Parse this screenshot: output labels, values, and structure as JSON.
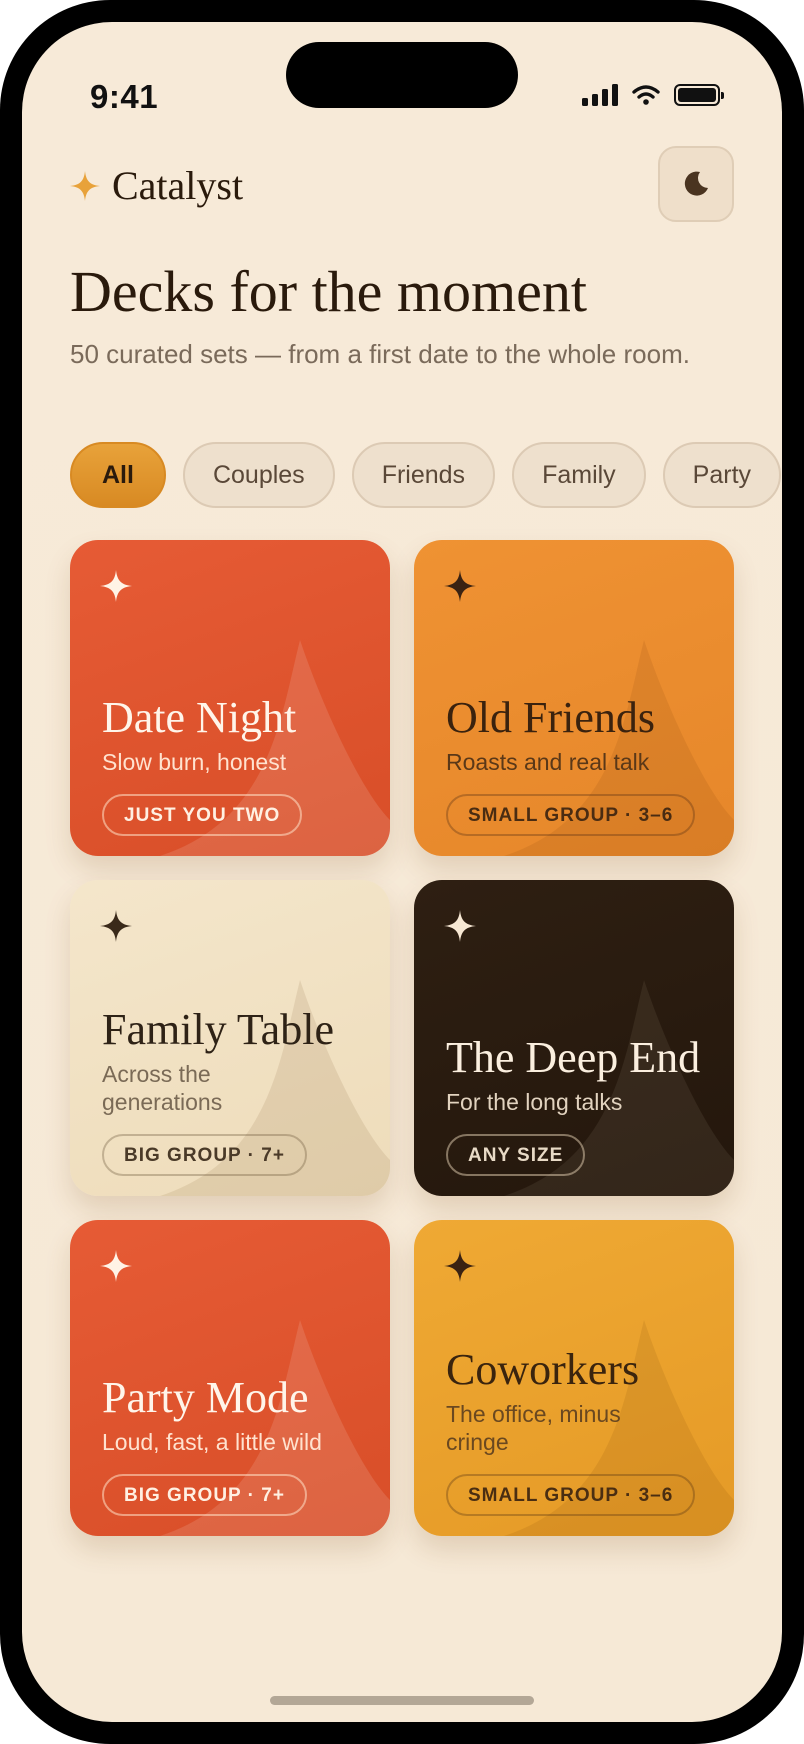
{
  "status_bar": {
    "time": "9:41"
  },
  "app": {
    "name": "Catalyst"
  },
  "header": {
    "title": "Decks for the moment",
    "subtitle": "50 curated sets — from a first date to the whole room."
  },
  "filters": [
    {
      "label": "All",
      "selected": true
    },
    {
      "label": "Couples",
      "selected": false
    },
    {
      "label": "Friends",
      "selected": false
    },
    {
      "label": "Family",
      "selected": false
    },
    {
      "label": "Party",
      "selected": false
    }
  ],
  "decks": [
    {
      "title": "Date Night",
      "subtitle": "Slow burn, honest",
      "badge": "JUST YOU TWO",
      "color": "#e65b35",
      "star_color": "#fff3e6"
    },
    {
      "title": "Old Friends",
      "subtitle": "Roasts and real talk",
      "badge": "SMALL GROUP · 3–6",
      "color": "#ef9233",
      "star_color": "#3a2212"
    },
    {
      "title": "Family Table",
      "subtitle": "Across the generations",
      "badge": "BIG GROUP · 7+",
      "color": "#f4e6cb",
      "star_color": "#3a2a1a"
    },
    {
      "title": "The Deep End",
      "subtitle": "For the long talks",
      "badge": "ANY SIZE",
      "color": "#2e1f12",
      "star_color": "#f7e8d4"
    },
    {
      "title": "Party Mode",
      "subtitle": "Loud, fast, a little wild",
      "badge": "BIG GROUP · 7+",
      "color": "#e65b35",
      "star_color": "#fff3e6"
    },
    {
      "title": "Coworkers",
      "subtitle": "The office, minus cringe",
      "badge": "SMALL GROUP · 3–6",
      "color": "#efa934",
      "star_color": "#3a2212"
    }
  ],
  "icons": {
    "brand": "sparkle-icon",
    "theme_toggle": "moon-icon",
    "deck": "sparkle-icon"
  },
  "colors": {
    "accent": "#e8a23a",
    "background": "#f7ead8"
  }
}
